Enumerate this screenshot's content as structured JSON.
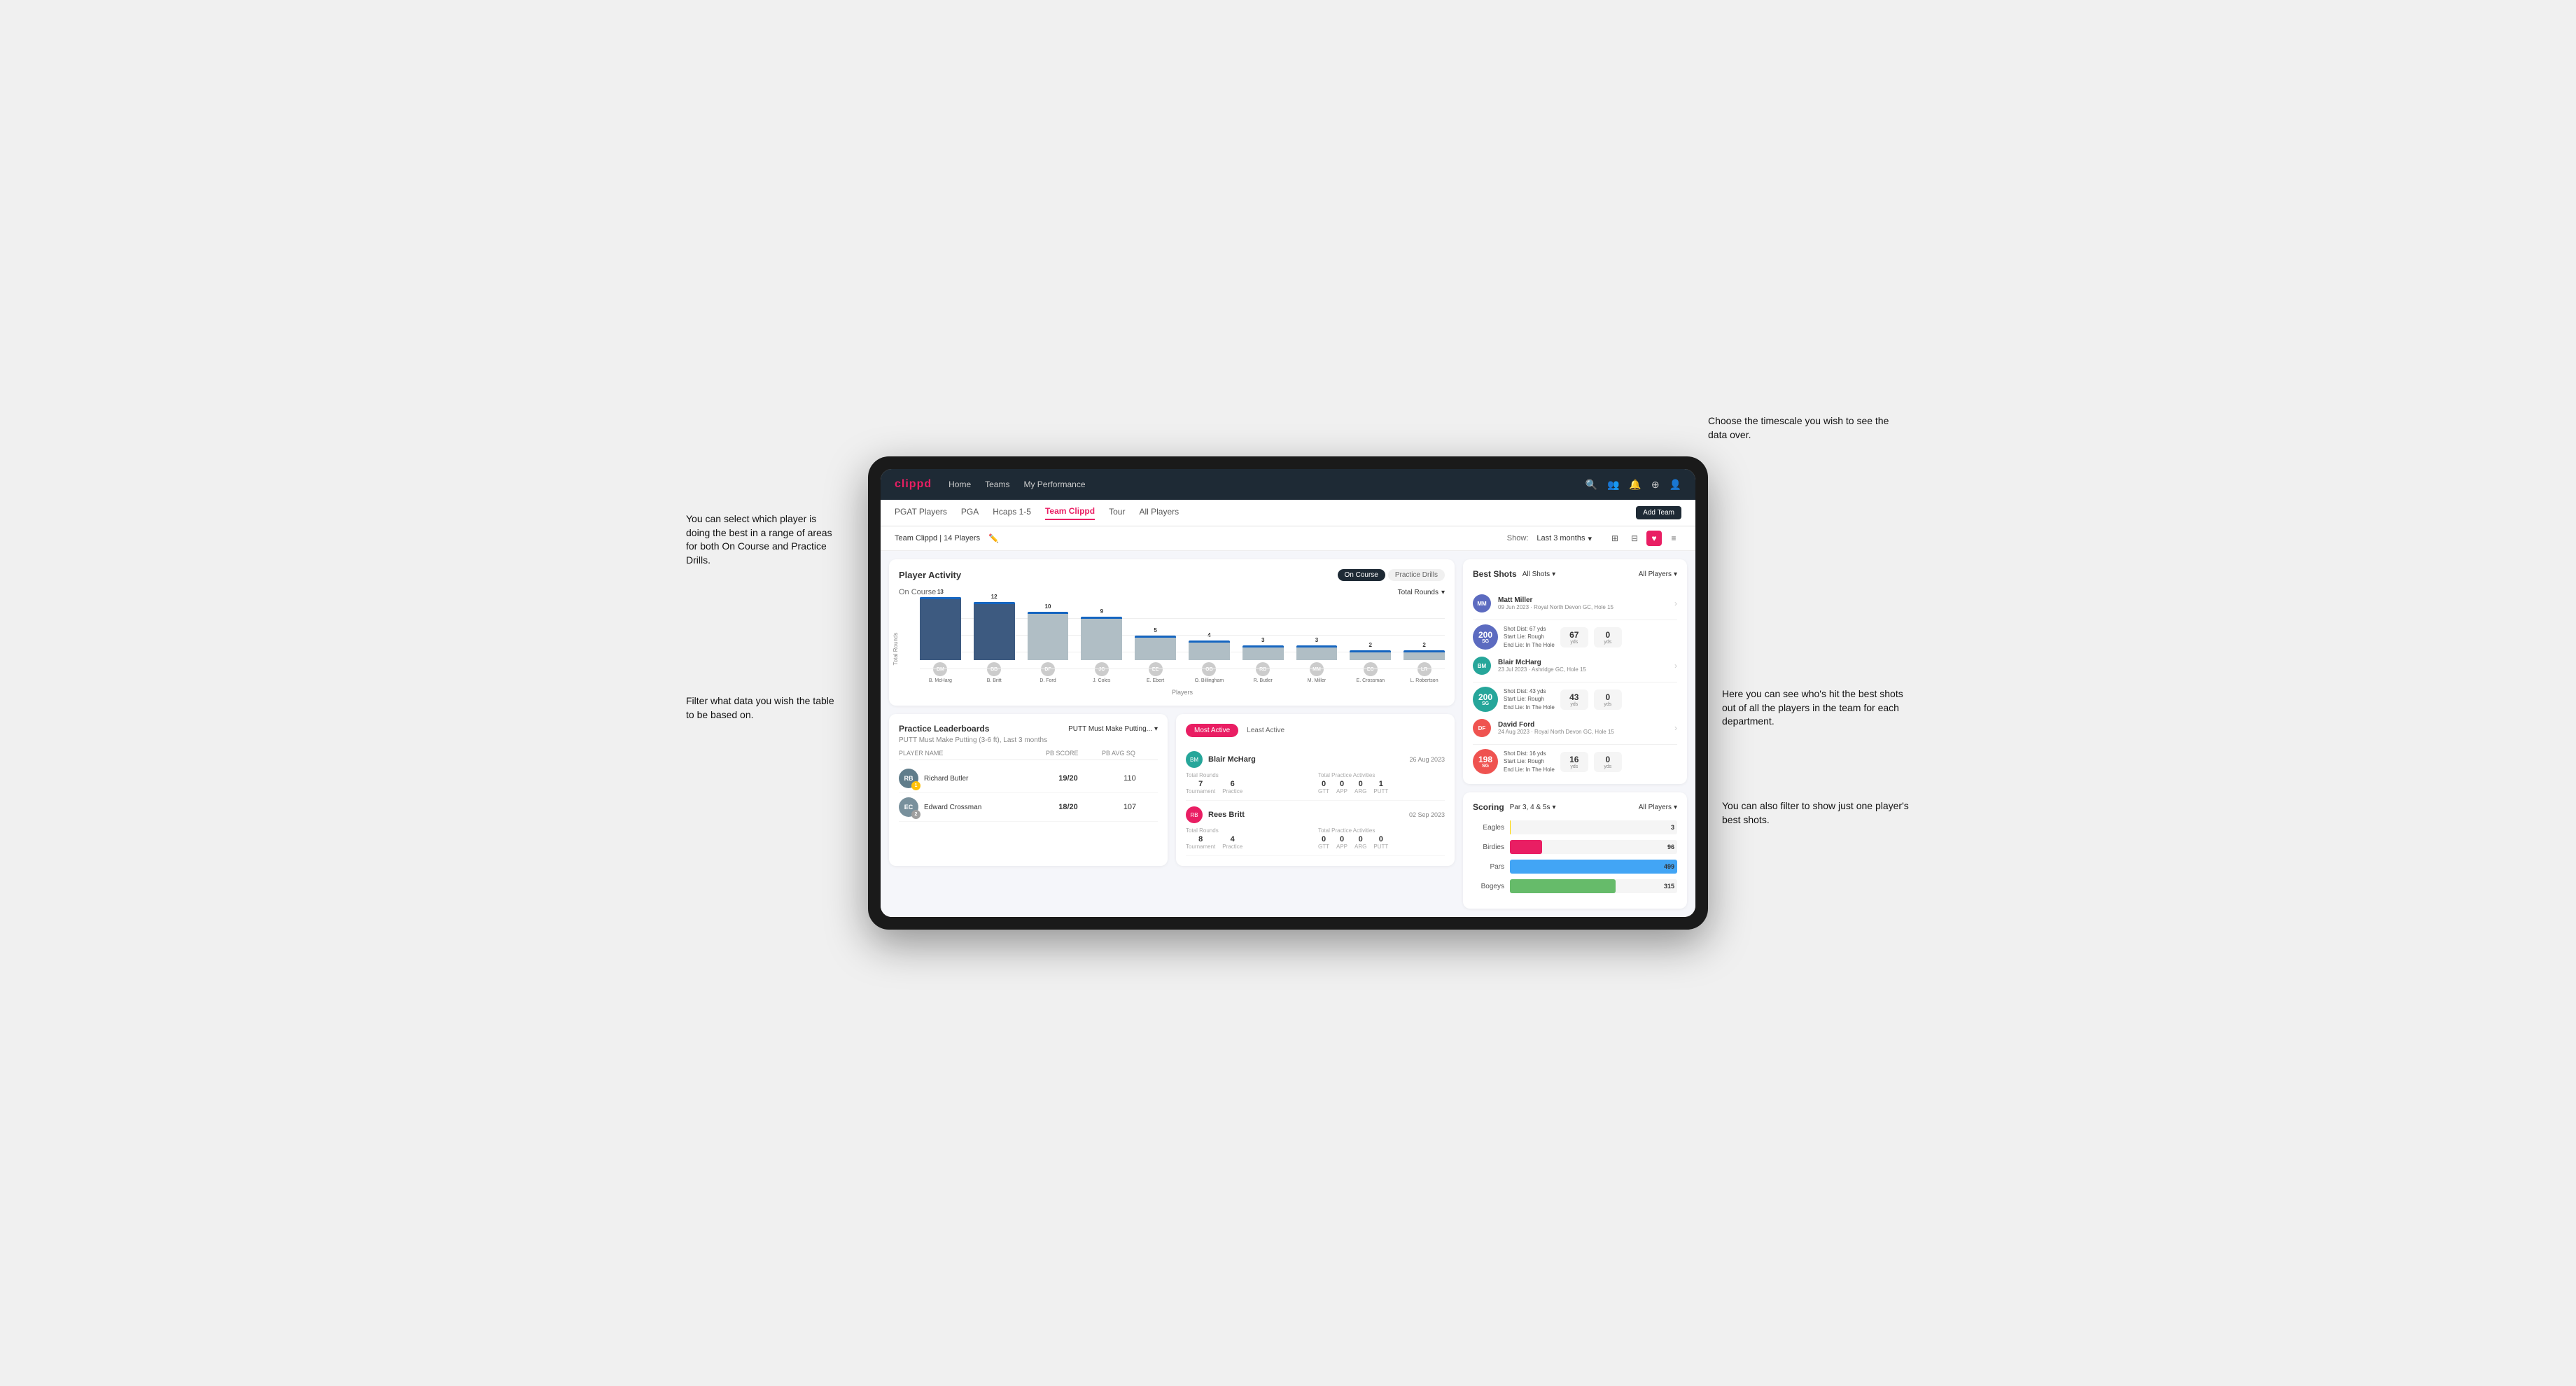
{
  "annotations": {
    "top_right": "Choose the timescale you wish to see the data over.",
    "left_top": "You can select which player is doing the best in a range of areas for both On Course and Practice Drills.",
    "left_bottom": "Filter what data you wish the table to be based on.",
    "right_mid": "Here you can see who's hit the best shots out of all the players in the team for each department.",
    "right_bottom": "You can also filter to show just one player's best shots."
  },
  "navbar": {
    "logo": "clippd",
    "links": [
      "Home",
      "Teams",
      "My Performance"
    ],
    "icons": [
      "search",
      "people",
      "bell",
      "add-circle",
      "profile"
    ]
  },
  "sub_tabs": [
    "PGAT Players",
    "PGA",
    "Hcaps 1-5",
    "Team Clippd",
    "Tour",
    "All Players"
  ],
  "active_sub_tab": "Team Clippd",
  "add_team_btn": "Add Team",
  "team_header": {
    "title": "Team Clippd | 14 Players",
    "show_label": "Show:",
    "timescale": "Last 3 months",
    "views": [
      "grid",
      "grid2",
      "heart",
      "list"
    ]
  },
  "player_activity": {
    "title": "Player Activity",
    "tabs": [
      "On Course",
      "Practice Drills"
    ],
    "active_tab": "On Course",
    "chart_label": "On Course",
    "chart_filter": "Total Rounds",
    "y_label": "Total Rounds",
    "x_label": "Players",
    "bars": [
      {
        "name": "B. McHarg",
        "value": 13,
        "highlighted": true
      },
      {
        "name": "B. Britt",
        "value": 12,
        "highlighted": true
      },
      {
        "name": "D. Ford",
        "value": 10,
        "highlighted": false
      },
      {
        "name": "J. Coles",
        "value": 9,
        "highlighted": false
      },
      {
        "name": "E. Ebert",
        "value": 5,
        "highlighted": false
      },
      {
        "name": "O. Billingham",
        "value": 4,
        "highlighted": false
      },
      {
        "name": "R. Butler",
        "value": 3,
        "highlighted": false
      },
      {
        "name": "M. Miller",
        "value": 3,
        "highlighted": false
      },
      {
        "name": "E. Crossman",
        "value": 2,
        "highlighted": false
      },
      {
        "name": "L. Robertson",
        "value": 2,
        "highlighted": false
      }
    ]
  },
  "practice_leaderboards": {
    "title": "Practice Leaderboards",
    "dropdown": "PUTT Must Make Putting...",
    "subtitle": "PUTT Must Make Putting (3-6 ft), Last 3 months",
    "columns": [
      "PLAYER NAME",
      "PB SCORE",
      "PB AVG SQ"
    ],
    "rows": [
      {
        "name": "Richard Butler",
        "rank": 1,
        "pb_score": "19/20",
        "pb_avg": "110",
        "initials": "RB",
        "color": "#607d8b"
      },
      {
        "name": "Edward Crossman",
        "rank": 2,
        "pb_score": "18/20",
        "pb_avg": "107",
        "initials": "EC",
        "color": "#78909c"
      }
    ]
  },
  "best_shots": {
    "title": "Best Shots",
    "filter": "All Shots",
    "players_filter": "All Players",
    "players": [
      {
        "name": "Matt Miller",
        "date": "09 Jun 2023",
        "location": "Royal North Devon GC, Hole 15",
        "sg_value": "200",
        "sg_label": "SG",
        "shot_dist": "Shot Dist: 67 yds",
        "start_lie": "Start Lie: Rough",
        "end_lie": "End Lie: In The Hole",
        "yds1": "67",
        "yds2": "0",
        "initials": "MM",
        "color": "#5c6bc0"
      },
      {
        "name": "Blair McHarg",
        "date": "23 Jul 2023",
        "location": "Ashridge GC, Hole 15",
        "sg_value": "200",
        "sg_label": "SG",
        "shot_dist": "Shot Dist: 43 yds",
        "start_lie": "Start Lie: Rough",
        "end_lie": "End Lie: In The Hole",
        "yds1": "43",
        "yds2": "0",
        "initials": "BM",
        "color": "#26a69a"
      },
      {
        "name": "David Ford",
        "date": "24 Aug 2023",
        "location": "Royal North Devon GC, Hole 15",
        "sg_value": "198",
        "sg_label": "SG",
        "shot_dist": "Shot Dist: 16 yds",
        "start_lie": "Start Lie: Rough",
        "end_lie": "End Lie: In The Hole",
        "yds1": "16",
        "yds2": "0",
        "initials": "DF",
        "color": "#ef5350"
      }
    ]
  },
  "most_active": {
    "tabs": [
      "Most Active",
      "Least Active"
    ],
    "active_tab": "Most Active",
    "players": [
      {
        "name": "Blair McHarg",
        "date": "26 Aug 2023",
        "initials": "BM",
        "color": "#26a69a",
        "total_rounds_label": "Total Rounds",
        "tournament": "7",
        "practice": "6",
        "practice_activities_label": "Total Practice Activities",
        "gtt": "0",
        "app": "0",
        "arg": "0",
        "putt": "1"
      },
      {
        "name": "Rees Britt",
        "date": "02 Sep 2023",
        "initials": "RB",
        "color": "#e91e63",
        "total_rounds_label": "Total Rounds",
        "tournament": "8",
        "practice": "4",
        "practice_activities_label": "Total Practice Activities",
        "gtt": "0",
        "app": "0",
        "arg": "0",
        "putt": "0"
      }
    ]
  },
  "scoring": {
    "title": "Scoring",
    "filter": "Par 3, 4 & 5s",
    "players_filter": "All Players",
    "bars": [
      {
        "label": "Eagles",
        "value": 3,
        "max": 500,
        "color": "#ffd700"
      },
      {
        "label": "Birdies",
        "value": 96,
        "max": 500,
        "color": "#e91e63"
      },
      {
        "label": "Pars",
        "value": 499,
        "max": 500,
        "color": "#42a5f5"
      },
      {
        "label": "Bogeys",
        "value": 315,
        "max": 500,
        "color": "#66bb6a"
      }
    ]
  }
}
